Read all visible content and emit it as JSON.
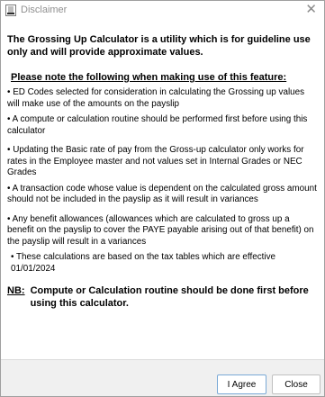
{
  "window": {
    "title": "Disclaimer",
    "close_glyph": "✕"
  },
  "content": {
    "intro": "The Grossing Up Calculator is a utility which is for guideline use only and will provide approximate values.",
    "notice_heading": "Please note the following when making use of this feature:",
    "notes": [
      "• ED Codes selected for consideration in calculating the Grossing up values will make use of the amounts on the payslip",
      "• A compute or calculation routine should be performed first before using this calculator",
      "• Updating the Basic rate of pay from the Gross-up calculator only works for rates in the Employee master and not values set in Internal Grades or NEC Grades",
      "• A transaction code whose value is dependent on the calculated gross amount should not be included in the payslip as it will result in variances",
      "• Any benefit allowances (allowances which are calculated to gross up a benefit on the payslip to cover the PAYE payable arising out of that benefit) on the payslip will result in a variances",
      "• These calculations are based on the tax tables which are effective 01/01/2024"
    ],
    "nb_label": "NB:",
    "nb_text": "Compute or Calculation routine should be done first before using this calculator."
  },
  "footer": {
    "agree_label": "I Agree",
    "close_label": "Close"
  },
  "icons": {
    "app": "app-icon",
    "close": "close-icon"
  }
}
